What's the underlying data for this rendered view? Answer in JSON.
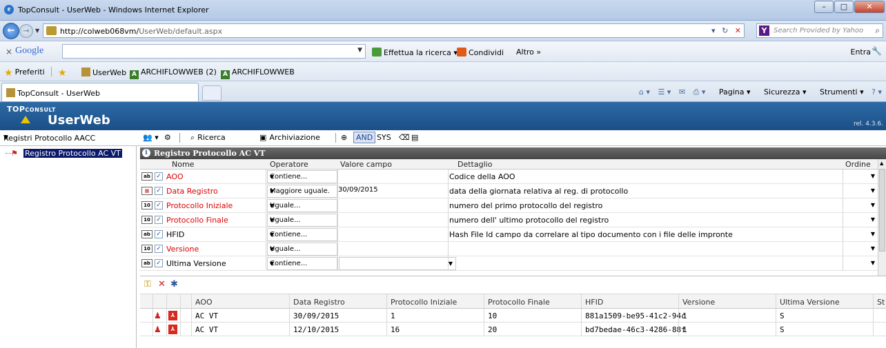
{
  "browser": {
    "window_title": "TopConsult - UserWeb - Windows Internet Explorer",
    "url_host": "http://colweb068vm/",
    "url_path": "UserWeb/default.aspx",
    "search_placeholder": "Search Provided by Yahoo",
    "google_logo": "Google",
    "google_search_label": "Effettua la ricerca",
    "google_share_label": "Condividi",
    "google_more_label": "Altro »",
    "google_signin": "Entra",
    "favorites_label": "Preferiti",
    "favorites": [
      "UserWeb",
      "ARCHIFLOWWEB (2)",
      "ARCHIFLOWWEB"
    ],
    "tab_title": "TopConsult - UserWeb",
    "command_bar": [
      "Pagina",
      "Sicurezza",
      "Strumenti"
    ]
  },
  "app": {
    "logo_text_top": "TOP",
    "logo_text_rest": "CONSULT",
    "title": "UserWeb",
    "version": "rel. 4.3.6."
  },
  "toolbar": {
    "registry_select": "Registri Protocollo AACC",
    "search_label": "Ricerca",
    "archive_label": "Archiviazione",
    "and_label": "AND",
    "sys_label": "SYS"
  },
  "tree": {
    "root": "Registro Protocollo AC VT"
  },
  "filter_panel": {
    "title": "Registro Protocollo AC VT",
    "columns": [
      "Nome",
      "Operatore",
      "Valore campo",
      "Dettaglio",
      "Ordine"
    ],
    "rows": [
      {
        "type": "ab",
        "name": "AOO",
        "required": true,
        "operator": "Contiene...",
        "value": "",
        "detail": "Codice della AOO"
      },
      {
        "type": "cal",
        "name": "Data Registro",
        "required": true,
        "operator": "Maggiore uguale.",
        "value": "30/09/2015",
        "detail": "data della giornata relativa al reg. di protocollo"
      },
      {
        "type": "10",
        "name": "Protocollo Iniziale",
        "required": true,
        "operator": "Uguale...",
        "value": "",
        "detail": "numero del primo protocollo del registro"
      },
      {
        "type": "10",
        "name": "Protocollo Finale",
        "required": true,
        "operator": "Uguale...",
        "value": "",
        "detail": "numero dell' ultimo protocollo del registro"
      },
      {
        "type": "ab",
        "name": "HFID",
        "required": false,
        "operator": "Contiene...",
        "value": "",
        "detail": "Hash File Id campo da correlare al tipo documento con i file delle impronte"
      },
      {
        "type": "10",
        "name": "Versione",
        "required": true,
        "operator": "Uguale...",
        "value": "",
        "detail": ""
      },
      {
        "type": "ab",
        "name": "Ultima Versione",
        "required": false,
        "operator": "Contiene...",
        "value": "",
        "detail": ""
      }
    ]
  },
  "results": {
    "columns": [
      "AOO",
      "Data Registro",
      "Protocollo Iniziale",
      "Protocollo Finale",
      "HFID",
      "Versione",
      "Ultima Versione",
      "St"
    ],
    "rows": [
      [
        "AC VT",
        "30/09/2015",
        "1",
        "10",
        "881a1509-be95-41c2-94c",
        "1",
        "S",
        ""
      ],
      [
        "AC VT",
        "12/10/2015",
        "16",
        "20",
        "bd7bedae-46c3-4286-88f",
        "1",
        "S",
        ""
      ]
    ]
  }
}
